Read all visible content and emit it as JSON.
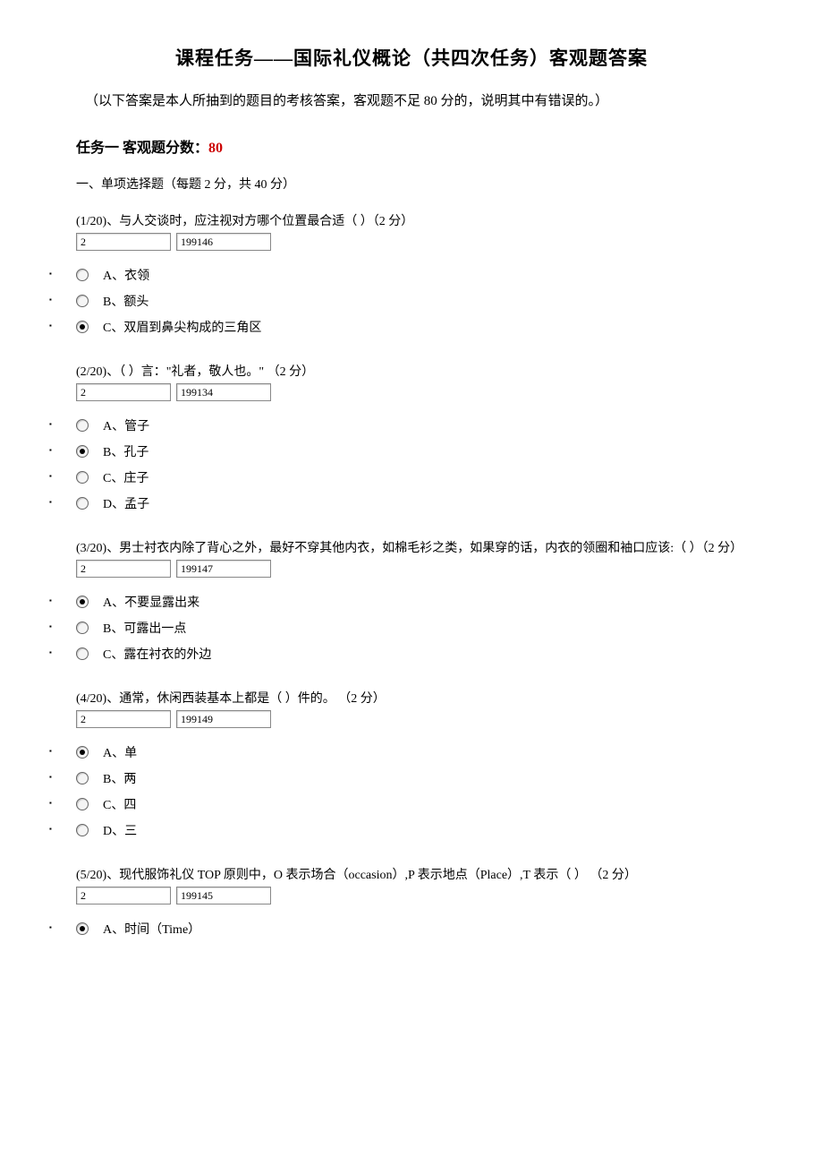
{
  "header": {
    "title": "课程任务——国际礼仪概论（共四次任务）客观题答案",
    "subtitle": "（以下答案是本人所抽到的题目的考核答案，客观题不足 80 分的，说明其中有错误的。）"
  },
  "task": {
    "label_prefix": "任务一 客观题分数：",
    "score": "80"
  },
  "section": {
    "description": "一、单项选择题（每题 2 分，共 40 分）"
  },
  "questions": [
    {
      "text": "(1/20)、与人交谈时，应注视对方哪个位置最合适（ ）（2 分）",
      "input1": "2",
      "input2": "199146",
      "selected": 2,
      "options": [
        "A、衣领",
        "B、额头",
        "C、双眉到鼻尖构成的三角区"
      ]
    },
    {
      "text": "(2/20)、（ ）言：\"礼者，敬人也。\" （2 分）",
      "input1": "2",
      "input2": "199134",
      "selected": 1,
      "options": [
        "A、管子",
        "B、孔子",
        "C、庄子",
        "D、孟子"
      ]
    },
    {
      "text": "(3/20)、男士衬衣内除了背心之外，最好不穿其他内衣，如棉毛衫之类，如果穿的话，内衣的领圈和袖口应该:（ ）（2 分）",
      "input1": "2",
      "input2": "199147",
      "selected": 0,
      "options": [
        "A、不要显露出来",
        "B、可露出一点",
        "C、露在衬衣的外边"
      ]
    },
    {
      "text": "(4/20)、通常，休闲西装基本上都是（ ）件的。 （2 分）",
      "input1": "2",
      "input2": "199149",
      "selected": 0,
      "options": [
        "A、单",
        "B、两",
        "C、四",
        "D、三"
      ]
    },
    {
      "text": "(5/20)、现代服饰礼仪 TOP 原则中，O 表示场合（occasion）,P 表示地点（Place）,T 表示（ ） （2 分）",
      "input1": "2",
      "input2": "199145",
      "selected": 0,
      "options": [
        "A、时间（Time）"
      ]
    }
  ]
}
